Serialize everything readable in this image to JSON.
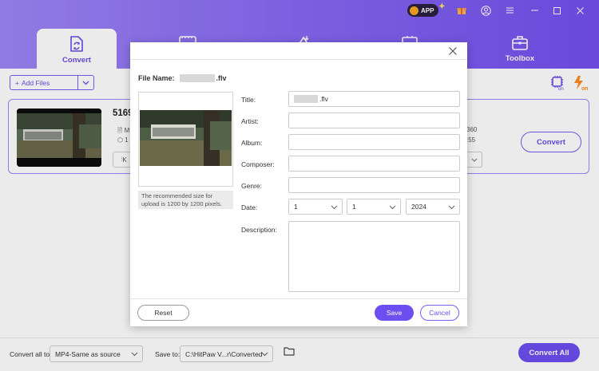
{
  "header": {
    "app_badge": "APP",
    "tabs": [
      {
        "label": "Convert",
        "icon": "convert-icon",
        "active": true
      },
      {
        "label": "",
        "icon": "download-icon",
        "active": false
      },
      {
        "label": "",
        "icon": "editor-icon",
        "active": false
      },
      {
        "label": "",
        "icon": "player-icon",
        "active": false
      },
      {
        "label": "Toolbox",
        "icon": "toolbox-icon",
        "active": false
      }
    ],
    "window_icons": [
      "gift-icon",
      "user-icon",
      "menu-icon",
      "minimize-icon",
      "maximize-icon",
      "close-icon"
    ]
  },
  "toolbar": {
    "add_files_label": "Add Files",
    "gpu_badge": "on",
    "flash_badge": "on"
  },
  "file_card": {
    "name_visible": "5169",
    "meta_line1_visible": "M",
    "meta_line2_visible": "1",
    "right_line1_visible": "360",
    "right_line2_visible": ":55",
    "selector_visible": "K",
    "convert_label": "Convert"
  },
  "bottom": {
    "convert_all_label": "Convert all to:",
    "convert_all_value": "MP4-Same as source",
    "save_to_label": "Save to:",
    "save_to_value": "C:\\HitPaw V...r\\Converted",
    "convert_all_button": "Convert All"
  },
  "dialog": {
    "file_name_label": "File Name:",
    "file_name_ext": ".flv",
    "thumbnail_note": "The recommended size for upload is 1200 by 1200 pixels.",
    "fields": {
      "title_label": "Title:",
      "title_ext": ".flv",
      "artist_label": "Artist:",
      "album_label": "Album:",
      "composer_label": "Composer:",
      "genre_label": "Genre:",
      "date_label": "Date:",
      "description_label": "Description:"
    },
    "date": {
      "month": "1",
      "day": "1",
      "year": "2024"
    },
    "buttons": {
      "reset": "Reset",
      "save": "Save",
      "cancel": "Cancel"
    }
  },
  "colors": {
    "accent": "#6d4ef0",
    "header_gradient_start": "#9d86f7",
    "header_gradient_end": "#7350ee"
  }
}
